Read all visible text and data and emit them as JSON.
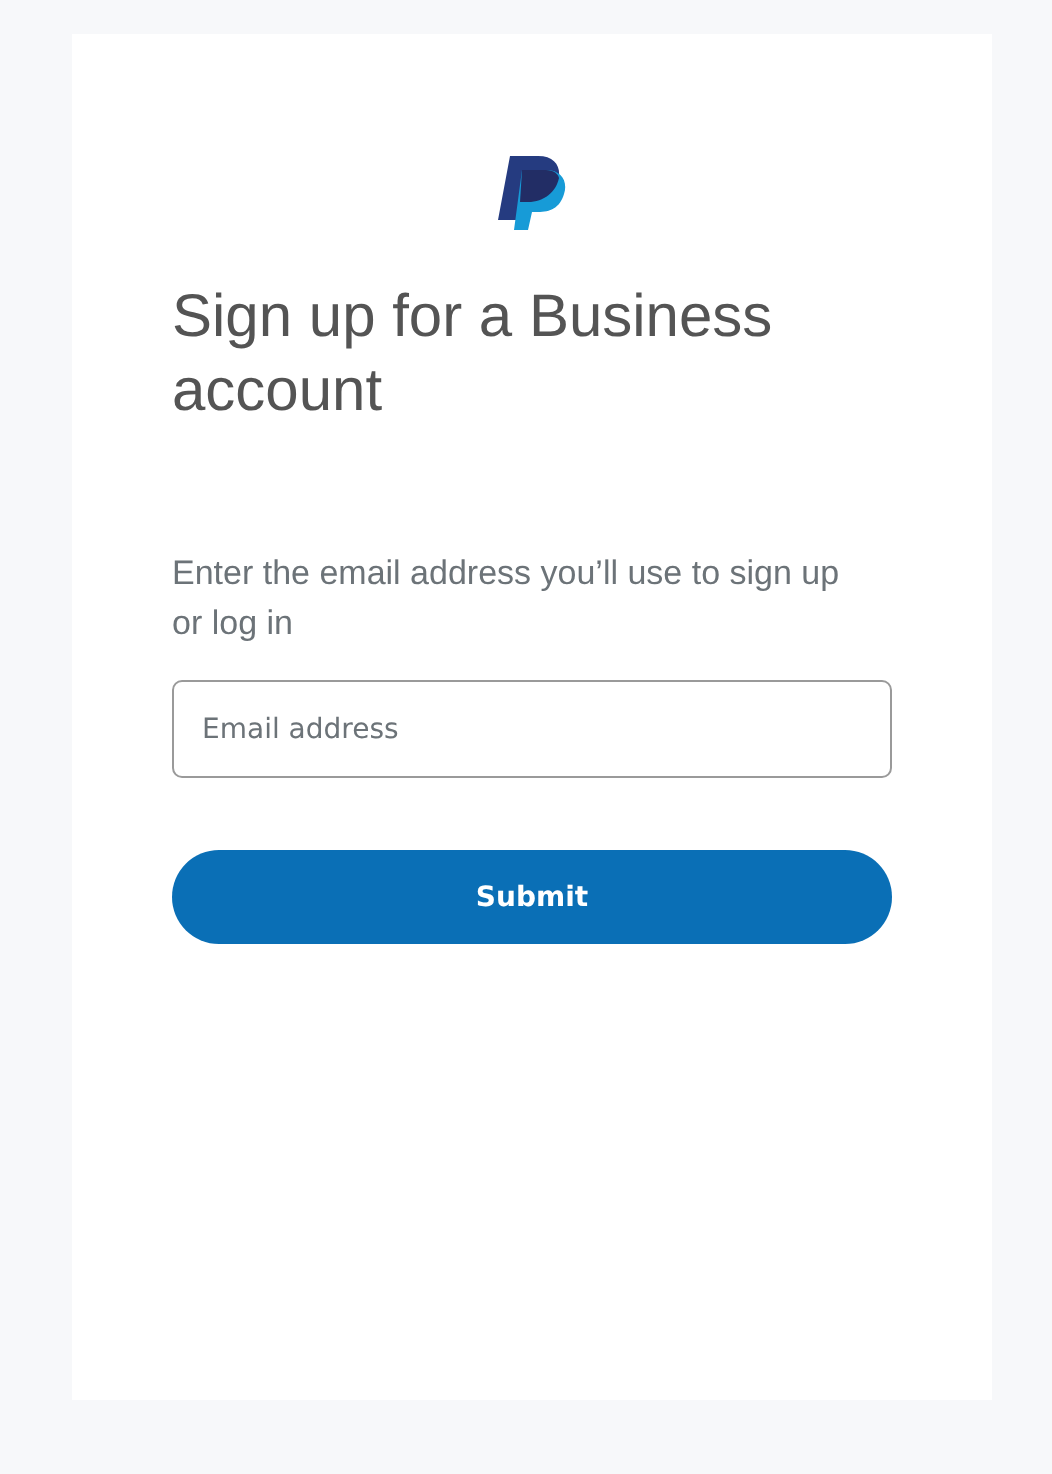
{
  "heading": "Sign up for a Business account",
  "instructions": "Enter the email address you’ll use to sign up or log in",
  "email_field": {
    "placeholder": "Email address"
  },
  "submit_button": {
    "label": "Submit"
  }
}
